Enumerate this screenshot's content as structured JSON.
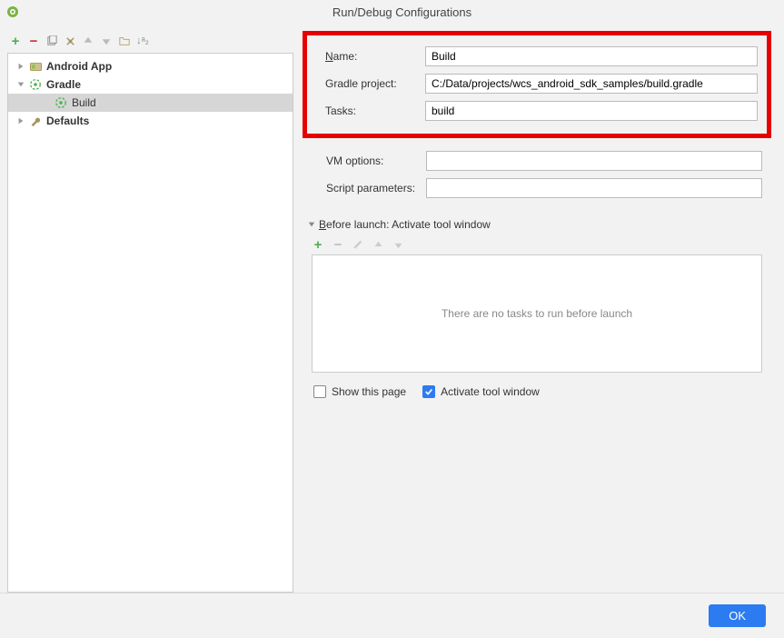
{
  "window": {
    "title": "Run/Debug Configurations"
  },
  "toolbar": {
    "add": "+",
    "remove": "−",
    "copy": "⧉",
    "settings": "⚙",
    "up": "↑",
    "down": "↓",
    "folder": "📁",
    "sort": "↓ᵃ₂"
  },
  "tree": {
    "items": [
      {
        "label": "Android App",
        "bold": true
      },
      {
        "label": "Gradle",
        "bold": true
      },
      {
        "label": "Build",
        "bold": false,
        "selected": true
      },
      {
        "label": "Defaults",
        "bold": true
      }
    ]
  },
  "form": {
    "name_label": "Name:",
    "name_value": "Build",
    "gradle_project_label": "Gradle project:",
    "gradle_project_value": "C:/Data/projects/wcs_android_sdk_samples/build.gradle",
    "tasks_label": "Tasks:",
    "tasks_value": "build",
    "vm_options_label": "VM options:",
    "vm_options_value": "",
    "script_params_label": "Script parameters:",
    "script_params_value": ""
  },
  "before_launch": {
    "header": "Before launch: Activate tool window",
    "empty_text": "There are no tasks to run before launch",
    "add": "+",
    "remove": "−",
    "edit": "✎",
    "up": "↑",
    "down": "↓"
  },
  "checkboxes": {
    "show_page": {
      "label": "Show this page",
      "checked": false
    },
    "activate_tool": {
      "label": "Activate tool window",
      "checked": true
    }
  },
  "buttons": {
    "ok": "OK"
  }
}
